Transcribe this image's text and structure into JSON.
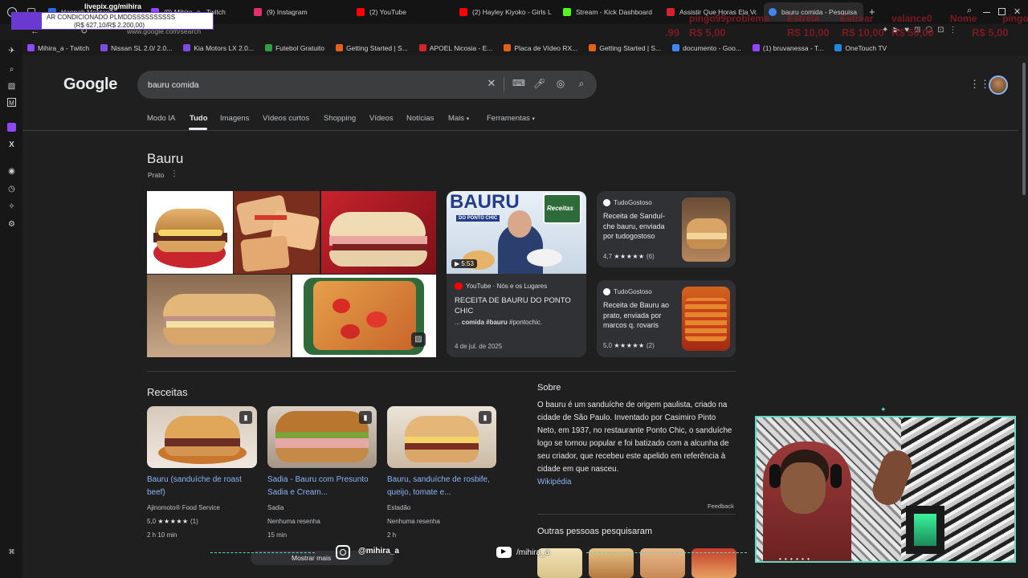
{
  "browser": {
    "tabs": [
      {
        "label": "Hannah Montana ...",
        "color": "#2d6cdf"
      },
      {
        "label": "(9) Mihira_a - Twitch",
        "color": "#9147ff"
      },
      {
        "label": "(9) Instagram",
        "color": "#e1306c"
      },
      {
        "label": "(2) YouTube",
        "color": "#ff0000"
      },
      {
        "label": "(2) Hayley Kiyoko - Girls L",
        "color": "#ff0000"
      },
      {
        "label": "Stream - Kick Dashboard",
        "color": "#53fc18"
      },
      {
        "label": "Assistir Que Horas Ela Vo",
        "color": "#d4232b"
      },
      {
        "label": "bauru comida - Pesquisa",
        "color": "#4285f4"
      }
    ],
    "new_tab_symbol": "+",
    "address": "www.google.com/search",
    "bookmarks": [
      {
        "label": "Mihira_a - Twitch",
        "color": "#9147ff"
      },
      {
        "label": "Nissan SL 2.0/ 2.0...",
        "color": "#7a4ce0"
      },
      {
        "label": "Kia Motors LX 2.0...",
        "color": "#7a4ce0"
      },
      {
        "label": "Futebol Gratuito",
        "color": "#2ea043"
      },
      {
        "label": "Getting Started | S...",
        "color": "#e2621b"
      },
      {
        "label": "APOEL Nicosia - E...",
        "color": "#d4232b"
      },
      {
        "label": "Placa de Vídeo RX...",
        "color": "#e2621b"
      },
      {
        "label": "Getting Started | S...",
        "color": "#e2621b"
      },
      {
        "label": "documento - Goo...",
        "color": "#4285f4"
      },
      {
        "label": "(1) bruvanessa - T...",
        "color": "#9147ff"
      },
      {
        "label": "OneTouch TV",
        "color": "#1e88e5"
      }
    ]
  },
  "stream_overlay": {
    "url": "livepix.gg/mihira",
    "ticker": "AR CONDICIONADO PLMDDSSSSSSSSSS",
    "goal": "(R$ 627,10/R$ 2.200,00)",
    "red_texts": [
      "pingo99problems",
      "Estrela",
      "Estrear",
      "valance0",
      "Nome",
      "pingo"
    ],
    "red_values": [
      ".99",
      "R$ 5,00",
      "R$ 10,00",
      "R$ 10,00",
      "R$ 50,00",
      "R$ 5,00"
    ],
    "instagram_handle": "@mihira_a",
    "youtube_handle": "/mihira_a"
  },
  "google": {
    "logo": "Google",
    "query": "bauru comida",
    "tabs": [
      "Modo IA",
      "Tudo",
      "Imagens",
      "Vídeos curtos",
      "Shopping",
      "Vídeos",
      "Notícias",
      "Mais",
      "Ferramentas"
    ],
    "selected_tab": "Tudo",
    "entity": {
      "title": "Bauru",
      "subtitle": "Prato"
    },
    "video": {
      "thumb_title": "BAURU",
      "thumb_sub": "DO PONTO CHIC",
      "thumb_badge": "Receitas",
      "duration": "5:53",
      "source": "YouTube · Nós e os Lugares",
      "title": "RECEITA DE BAURU DO PONTO CHIC",
      "snippet_prefix": "... ",
      "snippet_bold": "comida #bauru",
      "snippet_rest": " #pontochic.",
      "date": "4 de jul. de 2025"
    },
    "side_cards": [
      {
        "source": "TudoGostoso",
        "title": "Receita de Sanduí-che bauru, enviada por tudogostoso",
        "rating": "4,7",
        "stars": "★★★★★",
        "count": "(6)"
      },
      {
        "source": "TudoGostoso",
        "title": "Receita de Bauru ao prato, enviada por marcos q. rovaris",
        "rating": "5,0",
        "stars": "★★★★★",
        "count": "(2)"
      }
    ],
    "recipes_heading": "Receitas",
    "recipes": [
      {
        "title": "Bauru (sanduíche de roast beef)",
        "source": "Ajinomoto® Food Service",
        "rating": "5,0",
        "stars": "★★★★★",
        "count": "(1)",
        "time": "2 h 10 min"
      },
      {
        "title": "Sadia - Bauru com Presunto Sadia e Cream...",
        "source": "Sadia",
        "rating": "Nenhuma resenha",
        "stars": "",
        "count": "",
        "time": "15 min"
      },
      {
        "title": "Bauru, sanduíche de rosbife, queijo, tomate e...",
        "source": "Estadão",
        "rating": "Nenhuma resenha",
        "stars": "",
        "count": "",
        "time": "2 h"
      }
    ],
    "about": {
      "heading": "Sobre",
      "text": "O bauru é um sanduíche de origem paulista, criado na cidade de São Paulo. Inventado por Casimiro Pinto Neto, em 1937, no restaurante Ponto Chic, o sanduíche logo se tornou popular e foi batizado com a alcunha de seu criador, que recebeu este apelido em referência à cidade em que nasceu.",
      "link": "Wikipédia",
      "feedback": "Feedback"
    },
    "also_searched": "Outras pessoas pesquisaram",
    "show_more": "Mostrar mais"
  }
}
